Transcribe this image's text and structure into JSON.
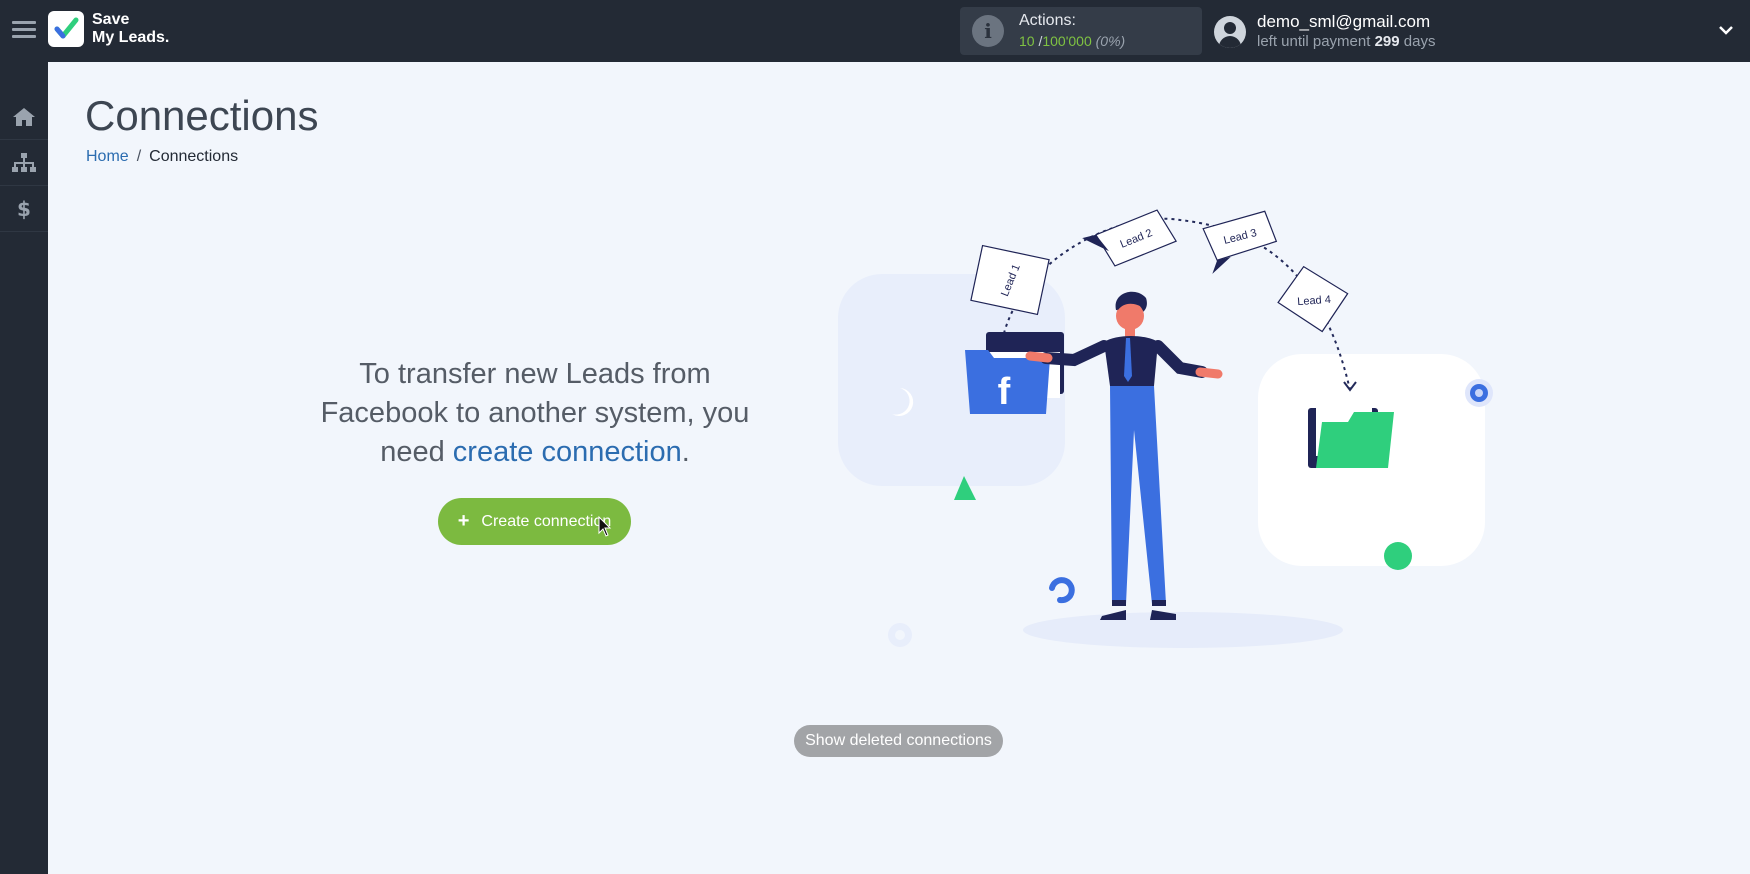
{
  "brand": {
    "name_line1": "Save",
    "name_line2": "My Leads."
  },
  "actions": {
    "label": "Actions:",
    "used": "10",
    "separator": "/",
    "limit": "100'000",
    "percent": "(0%)"
  },
  "user": {
    "email": "demo_sml@gmail.com",
    "payment_prefix": "left until payment",
    "payment_days": "299",
    "payment_suffix": "days"
  },
  "sidebar": {
    "items": [
      {
        "icon": "home-icon"
      },
      {
        "icon": "sitemap-icon"
      },
      {
        "icon": "dollar-icon"
      }
    ]
  },
  "page": {
    "title": "Connections",
    "breadcrumb": {
      "home": "Home",
      "separator": "/",
      "current": "Connections"
    }
  },
  "empty_state": {
    "text_before": "To transfer new Leads from Facebook to another system, you need ",
    "link": "create connection",
    "text_after": ".",
    "button_label": "Create connection",
    "button_icon": "plus-icon"
  },
  "illustration": {
    "leads": [
      "Lead 1",
      "Lead 2",
      "Lead 3",
      "Lead 4"
    ],
    "source_letter": "f"
  },
  "footer": {
    "show_deleted": "Show deleted connections"
  },
  "colors": {
    "topbar": "#232a35",
    "accent_green": "#7cba40",
    "link_blue": "#2b6cb0",
    "facebook_blue": "#3b6fe0",
    "folder_green": "#2fcf7d"
  }
}
